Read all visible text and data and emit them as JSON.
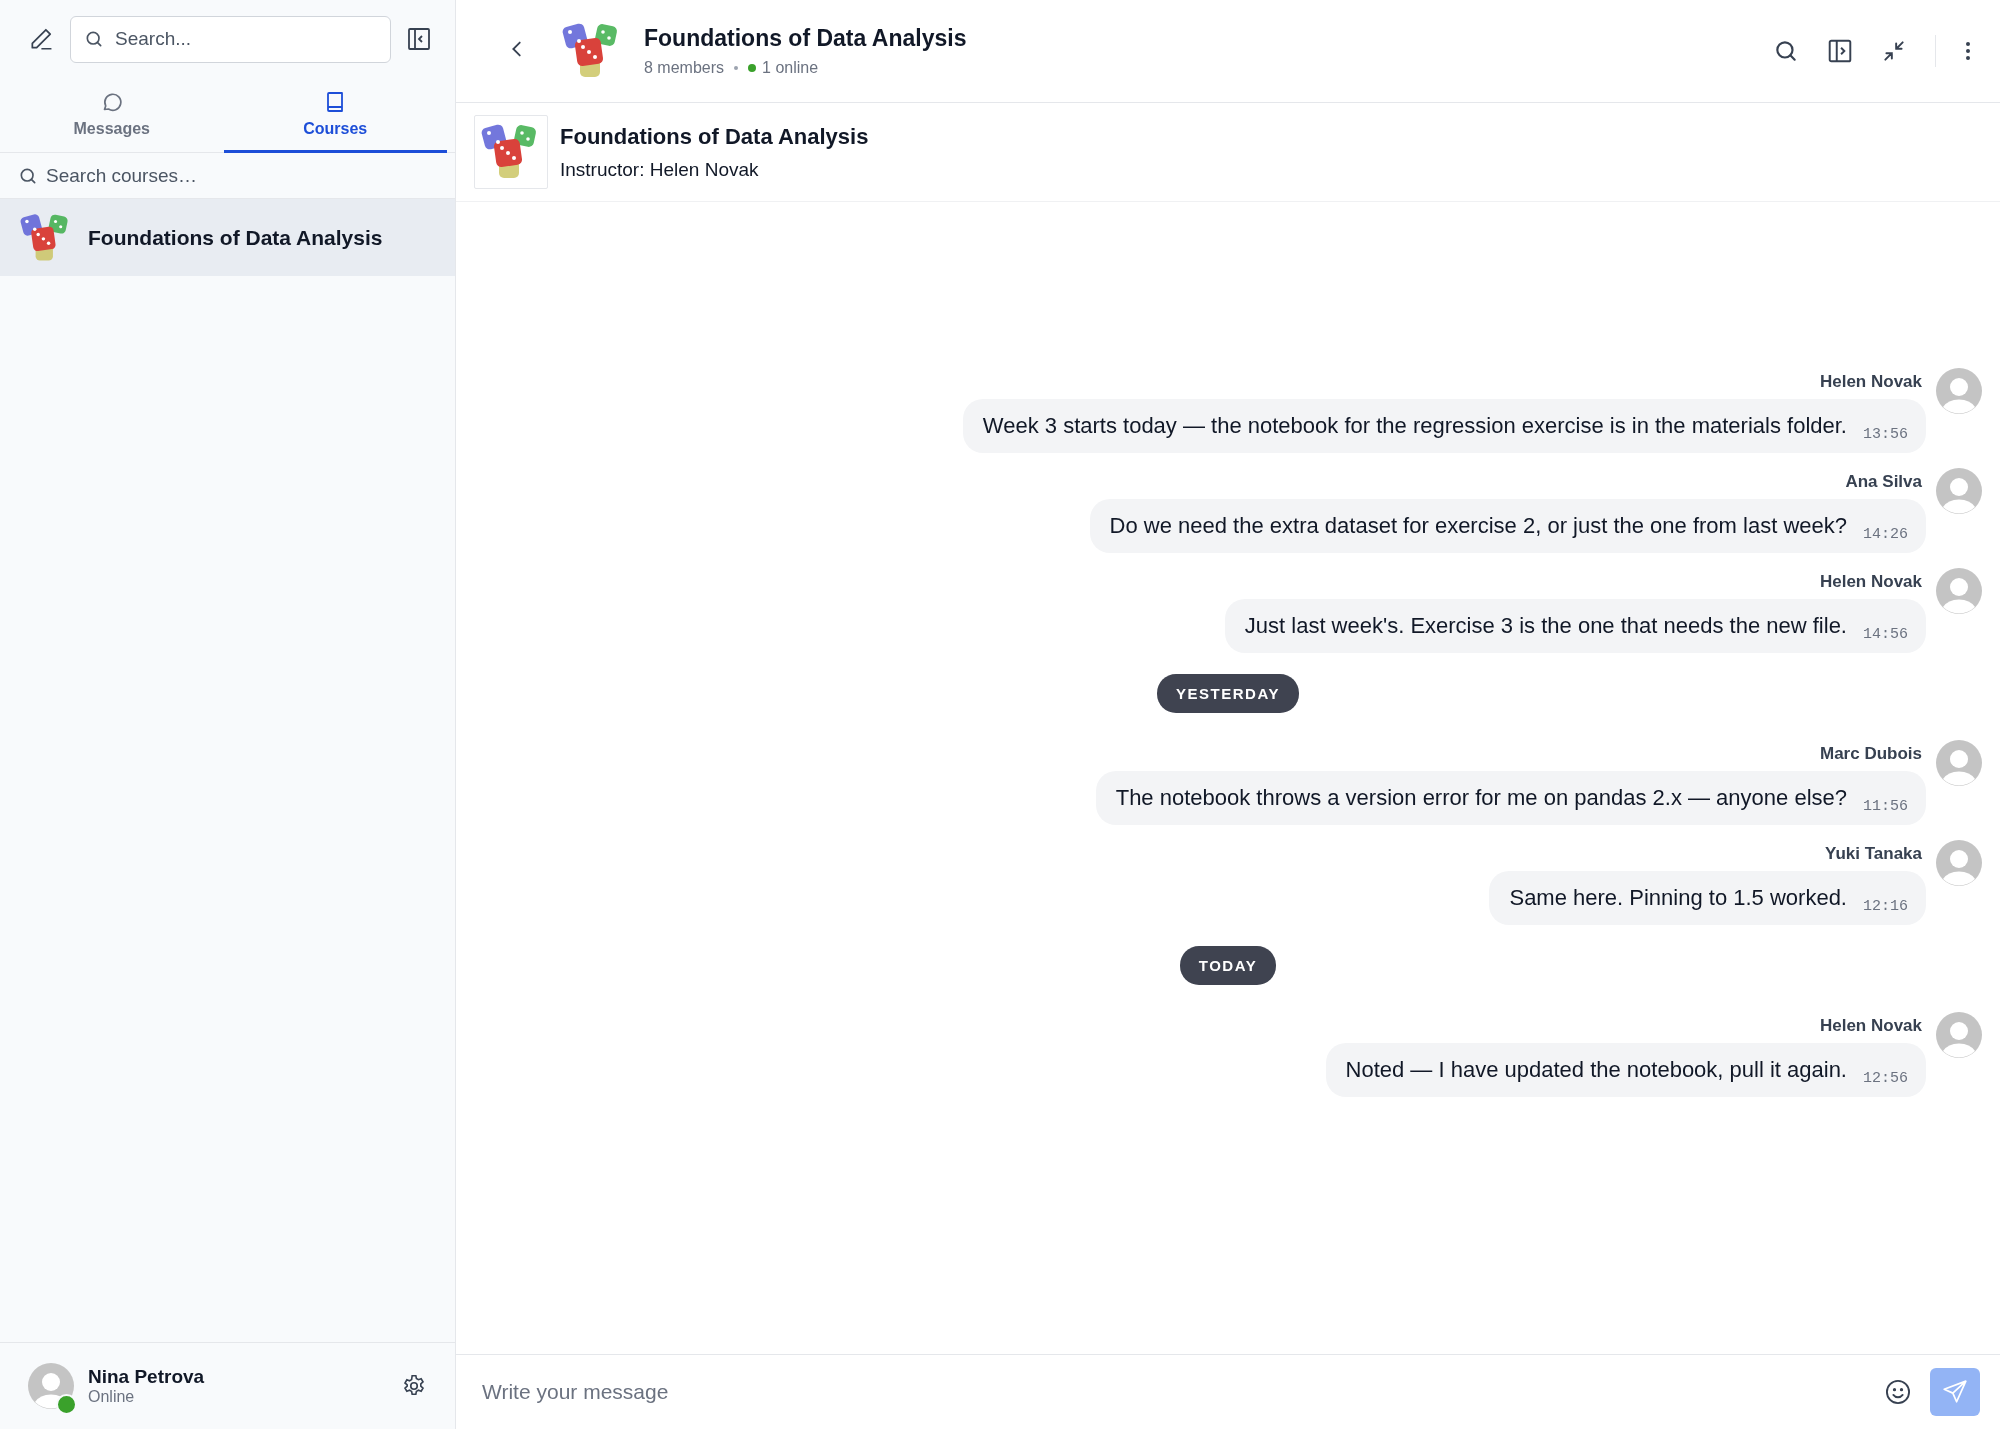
{
  "sidebar": {
    "search": {
      "placeholder": "Search..."
    },
    "tabs": [
      {
        "label": "Messages",
        "selected": false
      },
      {
        "label": "Courses",
        "selected": true
      }
    ],
    "course_search": {
      "placeholder": "Search courses…"
    },
    "courses": [
      {
        "title": "Foundations of Data Analysis",
        "selected": true
      }
    ],
    "user": {
      "name": "Nina Petrova",
      "status": "Online",
      "online": true
    }
  },
  "header": {
    "title": "Foundations of Data Analysis",
    "members": "8 members",
    "online": "1 online"
  },
  "banner": {
    "title": "Foundations of Data Analysis",
    "instructor": "Instructor: Helen Novak"
  },
  "timeline": [
    {
      "kind": "message",
      "sender": "Helen Novak",
      "text": "Week 3 starts today — the notebook for the regression exercise is in the materials folder.",
      "time": "13:56"
    },
    {
      "kind": "message",
      "sender": "Ana Silva",
      "text": "Do we need the extra dataset for exercise 2, or just the one from last week?",
      "time": "14:26"
    },
    {
      "kind": "message",
      "sender": "Helen Novak",
      "text": "Just last week's. Exercise 3 is the one that needs the new file.",
      "time": "14:56"
    },
    {
      "kind": "date",
      "label": "YESTERDAY"
    },
    {
      "kind": "message",
      "sender": "Marc Dubois",
      "text": "The notebook throws a version error for me on pandas 2.x — anyone else?",
      "time": "11:56"
    },
    {
      "kind": "message",
      "sender": "Yuki Tanaka",
      "text": "Same here. Pinning to 1.5 worked.",
      "time": "12:16"
    },
    {
      "kind": "date",
      "label": "TODAY"
    },
    {
      "kind": "message",
      "sender": "Helen Novak",
      "text": "Noted — I have updated the notebook, pull it again.",
      "time": "12:56"
    }
  ],
  "composer": {
    "placeholder": "Write your message"
  }
}
